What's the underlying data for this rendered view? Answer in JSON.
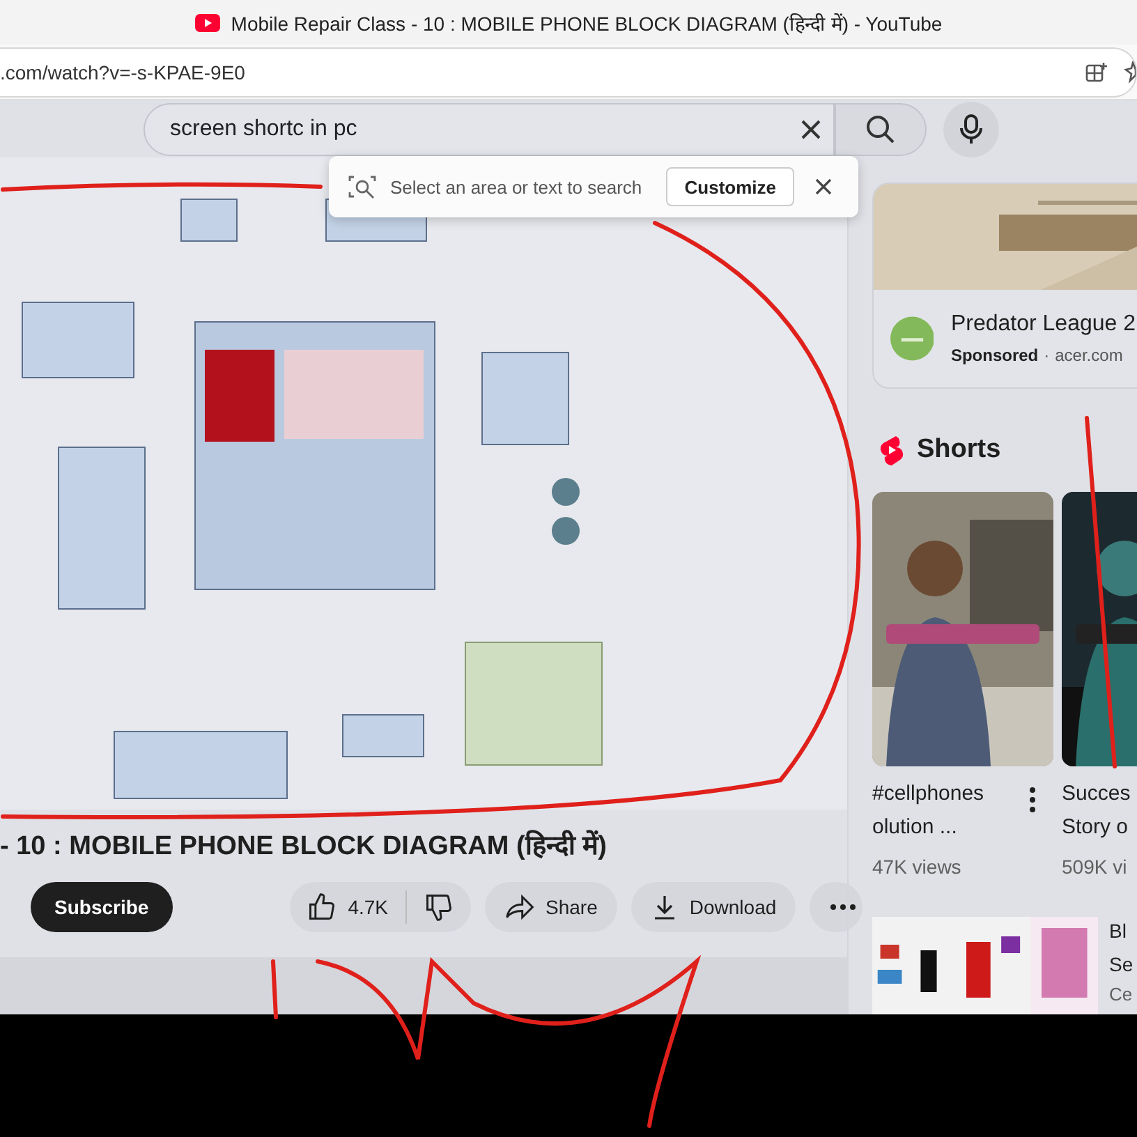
{
  "tab": {
    "title": "Mobile Repair Class - 10 : MOBILE PHONE BLOCK DIAGRAM (हिन्दी में) - YouTube"
  },
  "address_bar": {
    "url": ".com/watch?v=-s-KPAE-9E0"
  },
  "search": {
    "value": "screen shortc in pc"
  },
  "snip_popup": {
    "text": "Select an area or text to search",
    "button": "Customize"
  },
  "video": {
    "kind": "picture",
    "title": "- 10 : MOBILE PHONE BLOCK DIAGRAM (हिन्दी में)",
    "subscribe": "Subscribe",
    "likes": "4.7K",
    "share": "Share",
    "download": "Download"
  },
  "ad": {
    "title": "Predator League 2",
    "sponsored": "Sponsored",
    "separator": "·",
    "domain": "acer.com"
  },
  "shorts": {
    "heading": "Shorts",
    "items": [
      {
        "title_lines": [
          "#cellphones",
          "olution ..."
        ],
        "views": "47K views",
        "has_menu": true
      },
      {
        "title_lines": [
          "Succes",
          "Story o"
        ],
        "views": "509K vi"
      }
    ]
  },
  "recommended": [
    {
      "title_lines": [
        "Bl",
        "Se"
      ],
      "channel": "Ce"
    }
  ]
}
